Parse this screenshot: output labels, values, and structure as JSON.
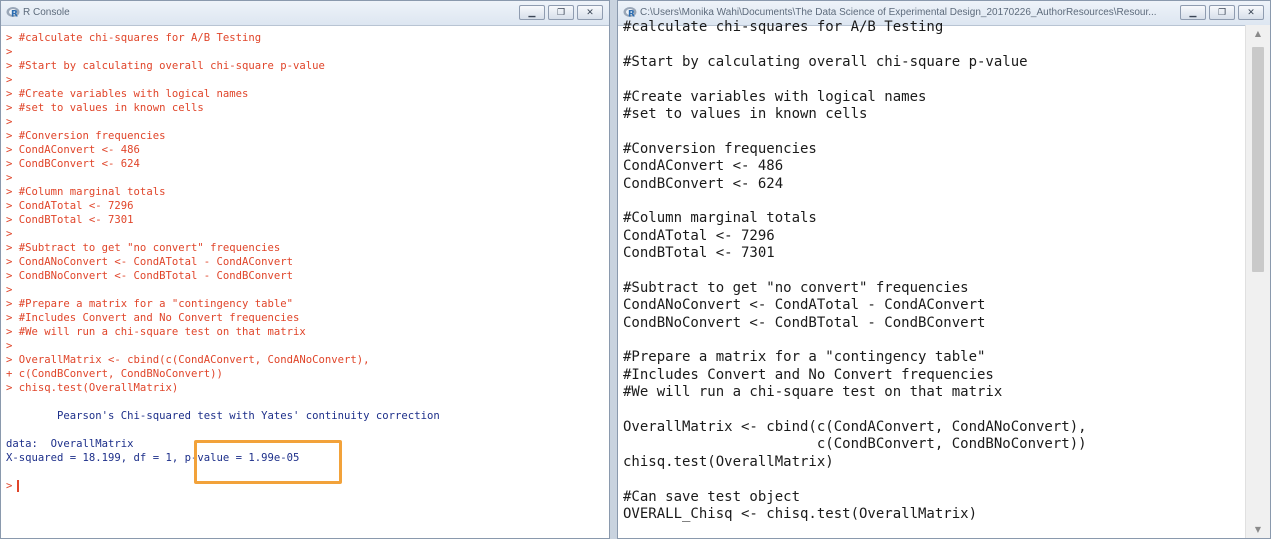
{
  "left_window": {
    "title": "R Console",
    "console_lines": [
      {
        "text": "> #calculate chi-squares for A/B Testing",
        "kind": "cmd"
      },
      {
        "text": ">",
        "kind": "cmd"
      },
      {
        "text": "> #Start by calculating overall chi-square p-value",
        "kind": "cmd"
      },
      {
        "text": ">",
        "kind": "cmd"
      },
      {
        "text": "> #Create variables with logical names",
        "kind": "cmd"
      },
      {
        "text": "> #set to values in known cells",
        "kind": "cmd"
      },
      {
        "text": ">",
        "kind": "cmd"
      },
      {
        "text": "> #Conversion frequencies",
        "kind": "cmd"
      },
      {
        "text": "> CondAConvert <- 486",
        "kind": "cmd"
      },
      {
        "text": "> CondBConvert <- 624",
        "kind": "cmd"
      },
      {
        "text": ">",
        "kind": "cmd"
      },
      {
        "text": "> #Column marginal totals",
        "kind": "cmd"
      },
      {
        "text": "> CondATotal <- 7296",
        "kind": "cmd"
      },
      {
        "text": "> CondBTotal <- 7301",
        "kind": "cmd"
      },
      {
        "text": ">",
        "kind": "cmd"
      },
      {
        "text": "> #Subtract to get \"no convert\" frequencies",
        "kind": "cmd"
      },
      {
        "text": "> CondANoConvert <- CondATotal - CondAConvert",
        "kind": "cmd"
      },
      {
        "text": "> CondBNoConvert <- CondBTotal - CondBConvert",
        "kind": "cmd"
      },
      {
        "text": ">",
        "kind": "cmd"
      },
      {
        "text": "> #Prepare a matrix for a \"contingency table\"",
        "kind": "cmd"
      },
      {
        "text": "> #Includes Convert and No Convert frequencies",
        "kind": "cmd"
      },
      {
        "text": "> #We will run a chi-square test on that matrix",
        "kind": "cmd"
      },
      {
        "text": ">",
        "kind": "cmd"
      },
      {
        "text": "> OverallMatrix <- cbind(c(CondAConvert, CondANoConvert),",
        "kind": "cmd"
      },
      {
        "text": "+ c(CondBConvert, CondBNoConvert))",
        "kind": "cmd"
      },
      {
        "text": "> chisq.test(OverallMatrix)",
        "kind": "cmd"
      },
      {
        "text": "",
        "kind": "out"
      },
      {
        "text": "        Pearson's Chi-squared test with Yates' continuity correction",
        "kind": "out"
      },
      {
        "text": "",
        "kind": "out"
      },
      {
        "text": "data:  OverallMatrix",
        "kind": "out"
      },
      {
        "text": "X-squared = 18.199, df = 1, p-value = 1.99e-05",
        "kind": "out"
      },
      {
        "text": "",
        "kind": "out"
      }
    ],
    "prompt": ">"
  },
  "right_window": {
    "title": "C:\\Users\\Monika Wahi\\Documents\\The Data Science of Experimental Design_20170226_AuthorResources\\Resour...",
    "editor_lines": [
      "#calculate chi-squares for A/B Testing",
      "",
      "#Start by calculating overall chi-square p-value",
      "",
      "#Create variables with logical names",
      "#set to values in known cells",
      "",
      "#Conversion frequencies",
      "CondAConvert <- 486",
      "CondBConvert <- 624",
      "",
      "#Column marginal totals",
      "CondATotal <- 7296",
      "CondBTotal <- 7301",
      "",
      "#Subtract to get \"no convert\" frequencies",
      "CondANoConvert <- CondATotal - CondAConvert",
      "CondBNoConvert <- CondBTotal - CondBConvert",
      "",
      "#Prepare a matrix for a \"contingency table\"",
      "#Includes Convert and No Convert frequencies",
      "#We will run a chi-square test on that matrix",
      "",
      "OverallMatrix <- cbind(c(CondAConvert, CondANoConvert),",
      "                       c(CondBConvert, CondBNoConvert))",
      "chisq.test(OverallMatrix)",
      "",
      "#Can save test object",
      "OVERALL_Chisq <- chisq.test(OverallMatrix)"
    ]
  },
  "colors": {
    "command": "#e0452a",
    "output": "#1d2f8a",
    "highlight": "#f2a23a"
  }
}
